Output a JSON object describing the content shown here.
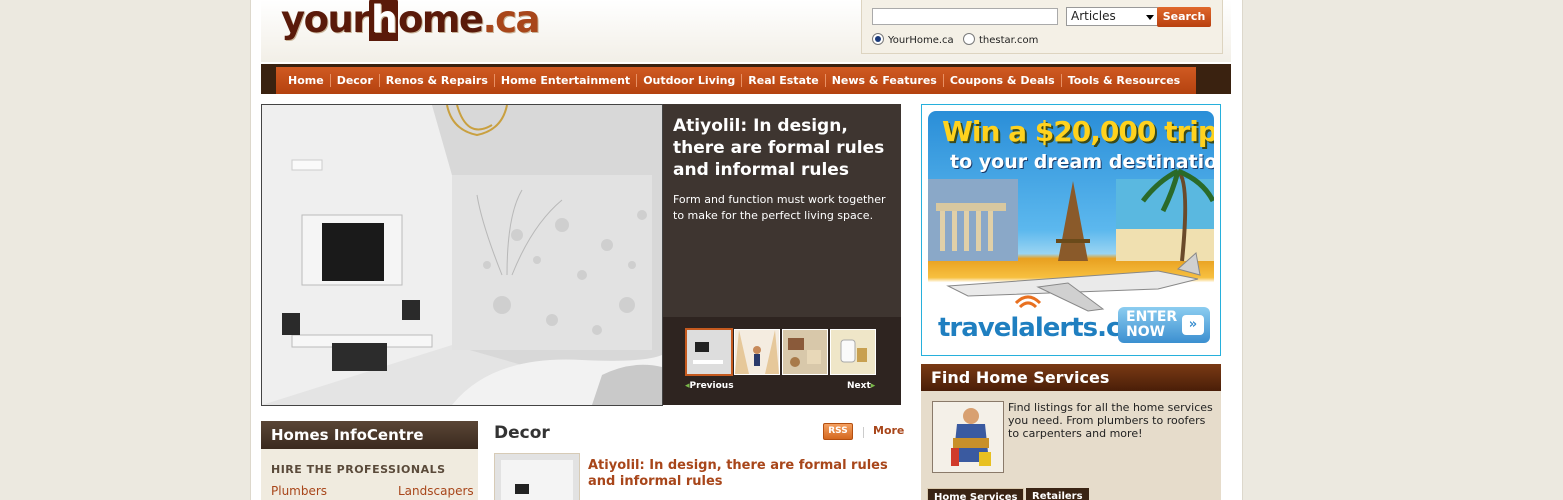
{
  "header": {
    "logo": {
      "part1": "your",
      "part2": "h",
      "part3": "ome",
      "part4": ".ca"
    },
    "search": {
      "query": "",
      "select_value": "Articles",
      "button": "Search",
      "radios": [
        {
          "label": "YourHome.ca",
          "checked": true
        },
        {
          "label": "thestar.com",
          "checked": false
        }
      ]
    }
  },
  "nav": {
    "items": [
      "Home",
      "Decor",
      "Renos & Repairs",
      "Home Entertainment",
      "Outdoor Living",
      "Real Estate",
      "News & Features",
      "Coupons & Deals",
      "Tools & Resources"
    ]
  },
  "hero": {
    "title": "Atiyolil: In design, there are formal rules and informal rules",
    "description": "Form and function must work together to make for the perfect living space.",
    "prev": "Previous",
    "next": "Next",
    "active_thumb": 1
  },
  "ad": {
    "line1": "Win a $20,000 trip",
    "line2": "to your dream destination",
    "brand": "travelalerts.ca",
    "cta_line1": "ENTER",
    "cta_line2": "NOW"
  },
  "find_home_services": {
    "title": "Find Home Services",
    "text": "Find listings for all the home services you need.  From plumbers to roofers to carpenters and more!",
    "tabs": [
      "Home Services",
      "Retailers"
    ]
  },
  "homes_infocentre": {
    "title": "Homes InfoCentre",
    "subheading": "HIRE THE PROFESSIONALS",
    "links": [
      "Plumbers",
      "Landscapers"
    ]
  },
  "decor": {
    "title": "Decor",
    "rss": "RSS",
    "more": "More",
    "article_title": "Atiyolil: In design, there are formal rules and informal rules"
  },
  "colors": {
    "accent": "#c55a1f",
    "link": "#a8461a",
    "nav_bg": "#3a2210"
  }
}
